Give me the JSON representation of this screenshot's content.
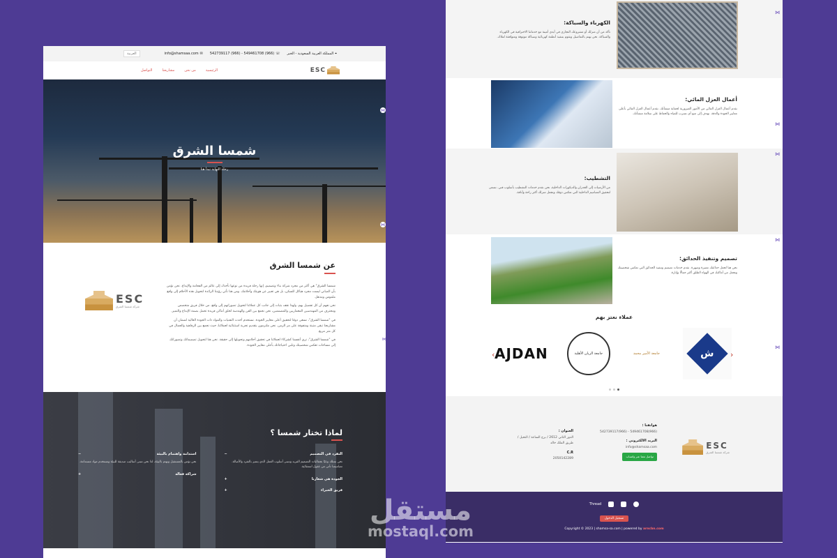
{
  "topbar": {
    "location": "المملكة العربية السعودية - الخبر",
    "phone": "(966) 549461708 - (966) 542739117",
    "email": "info@shamsaa.com",
    "language": "العربية"
  },
  "nav": {
    "logo_text": "ESC",
    "items": [
      "الرئيسية",
      "من نحن",
      "مشاريعنا",
      "التواصل"
    ]
  },
  "hero": {
    "title": "شمسا الشرق",
    "subtitle": "رحلة النهاية تبدأ هنا"
  },
  "about": {
    "title": "عن شمسا الشرق",
    "logo_text": "ESC",
    "logo_sub": "شركة شمسا الشرق",
    "paragraphs": [
      "شمسا الشرق\" هي أكثر من مجرد شركة بناء وتصميم، إنها رحلة فريدة من نوعها تأخذك إلى عالم من الفخامة والإبداع. نحن نؤمن بأن المباني ليست مجرد هياكل للسكن، بل هي تعبير عن هويتك وأحلامك. ومن هنا تأتي رؤيتنا الرائدة لتحويل هذه الأحلام إلى واقع ملموس ومذهل.",
      "نحن نفهم أن كل تفصيل يهم، ولهذا نقف بثبات إلى جانب كل عملائنا لتحويل تصوراتهم إلى واقع. من خلال فريق متخصص ومحترف من المهندسين المعماريين والمصممين، نحن نجمع بين الفن والهندسة لخلق أماكن فريدة تحمل بصمة الإبداع والتميز.",
      "في \"شمسا الشرق\"، نسعى دومًا لتحقيق أعلى معايير الجودة. نستخدم أحدث التقنيات والمواد ذات الجودة العالية لضمان أن مشاريعنا تبقى متينة ومتفوقة على مر الزمن. نحن ملتزمون بتقديم تجربة استثنائية لعملائنا، حيث نجمع بين الرفاهية والجمال في كل متر مربع.",
      "في \"شمسا الشرق\"، نرى أنفسنا كشركاء لعملائنا في تحقيق أحلامهم وتحويلها إلى حقيقة. نحن هنا لتحويل تصميماتك وتصوراتك إلى مساحات تعكس شخصيتك وتلبي احتياجاتك بأعلى معايير الجودة."
    ]
  },
  "why": {
    "title": "لماذا تختار شمسا ؟",
    "items": [
      {
        "title": "التفرد في التصميم",
        "body": "نحن نمتلك وعيًا بجماليات التصميم الفريد ونتبنى أسلوب العمل الذي يتميز بالتفرد والأصالة. تصاميمنا تأتي من عقول استثنائية.",
        "open": true
      },
      {
        "title": "استدامة واهتمام بالبيئة",
        "body": "نحن نؤمن بالمستقبل ونهتم بالبيئة، لذا نحن نتبنى أساليب صديقة للبيئة ونستخدم مواد مستدامة.",
        "open": true
      },
      {
        "title": "الجودة هي شعارنا",
        "body": "",
        "open": false
      },
      {
        "title": "شراكة فعالة",
        "body": "",
        "open": false
      },
      {
        "title": "فريق الخبراء",
        "body": "",
        "open": false
      }
    ]
  },
  "services": [
    {
      "title": "الكهرباء والسباكة:",
      "body": "تأكد من أن منزلك أو مشروعك التجاري في أيدي أمينة مع خدماتنا الاحترافية في الكهرباء والسباكة. نحن نهتم بالتفاصيل ونقوم بتنفيذ أنظمة كهربائية وسباكة موثوقة ومتوافقة لملاك."
    },
    {
      "title": "أعمال العزل المائي:",
      "body": "نقدم أعمال العزل المائي من الأمور الضرورية لحماية منشآتك. نقدم أعمال العزل المائي بأعلى معايير الجودة والدقة. نهدف إلى منع أي تسرب للمياه والحفاظ على سلامة منشآتك."
    },
    {
      "title": "التشطيب:",
      "body": "من الأرضيات إلى الجدران والديكورات الداخلية، نحن نقدم خدمات التشطيب بأسلوب فني. نسعى لتحقيق التصاميم الداخلية التي تعكس ذوقك وتجعل منزلك أكثر راحة وأناقة."
    },
    {
      "title": "تصميم وتنفيذ الحدائق:",
      "body": "نحن هنا لجعل حدائقك مميزة ومبهرة. نقدم خدمات تصميم وتنفيذ الحدائق التي تعكس شخصيتك وتجعل من أماكنك في الهواء الطلق أكثر جمالًا وإثارة."
    }
  ],
  "clients": {
    "title": "عملاء نعتز بهم",
    "logos": [
      "AJDAN",
      "جامعة الأمير محمد",
      "جامعة الريان الأهلية",
      "ش"
    ]
  },
  "footer": {
    "phones_label": "هواتفنا :",
    "phones": "(966)549461708 - (966)542739117",
    "email_label": "البريد الالكتروني :",
    "email": "info@shamsaa.com",
    "whatsapp_btn": "تواصل معنا عبر واتساب",
    "address_label": "العنوان :",
    "address": "الدور الثاني 2612 / برج الساعة / النخيل / طريق الملك خالد",
    "cr_label": "C.R",
    "cr": "2050142289",
    "social_text": "Thread",
    "login_btn": "تسجيل الدخول",
    "copyright": "Copyright © 2023 | shamsa-sa.com | powered by",
    "powered": "arncbn.com"
  },
  "watermark": {
    "ar": "مستقل",
    "en": "mostaql.com"
  },
  "colors": {
    "background": "#4e3b94",
    "accent": "#d9534f",
    "footer_dark": "#3a2d66"
  }
}
